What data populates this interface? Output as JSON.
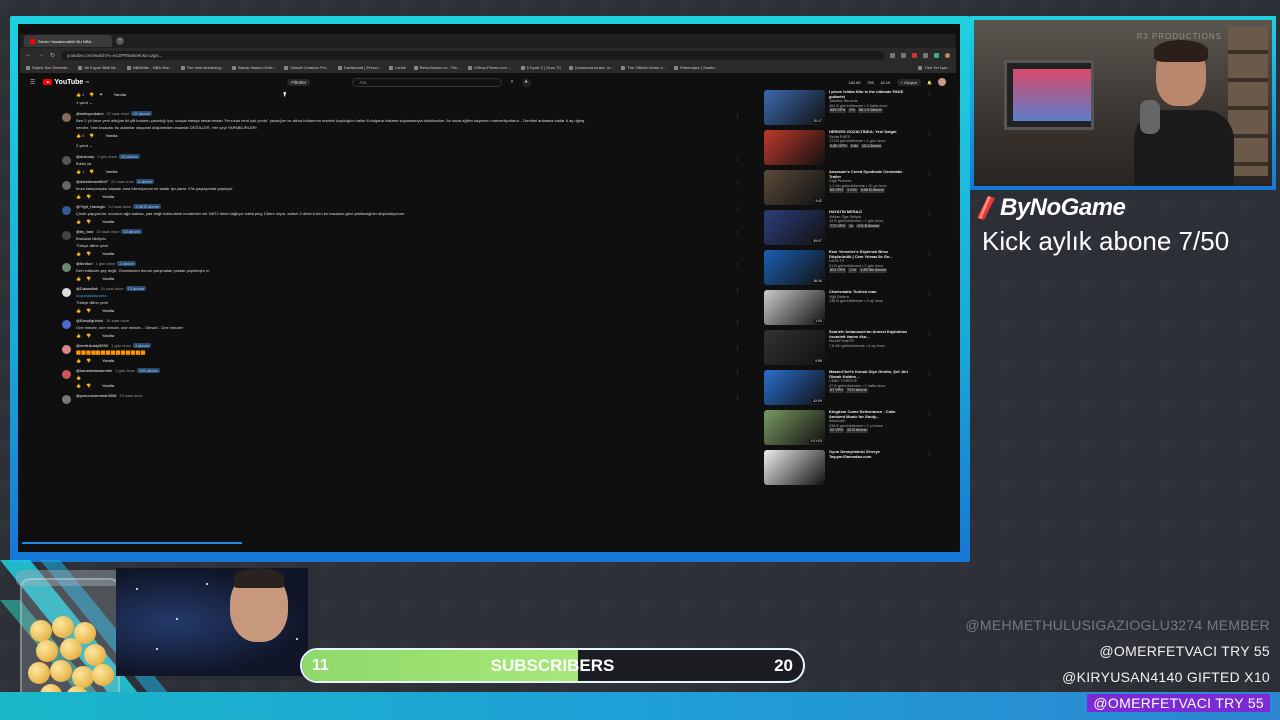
{
  "browser": {
    "tab_title": "Steam Yasaklanabilir BU NBA...",
    "url": "youtube.com/watch?v=e1ZPR9oBe9c&t=Ugxt...",
    "bookmarks": [
      "Süpriz Son Sevenle...",
      "Ali Koyun Bildi Mi...",
      "NBA/Nite - NBA Stre...",
      "The best streaming...",
      "Bando Namco Ente...",
      "Ubisoft Creators Pro...",
      "Dashboard | Prezzi...",
      "Lunkit",
      "RetroGames.cc - Pla...",
      "eShop-Prices.com -...",
      "5 Sport 2 | Zeus TV",
      "Download music, m...",
      "The Official Home o...",
      "Patreonpor | Seafer..."
    ],
    "bookmarks_right": "Tüm Yer İşar..."
  },
  "youtube": {
    "logo": "YouTube",
    "logo_sup": "TR",
    "filters_label": "Filtreler",
    "search_placeholder": "Ara",
    "create_label": "Oluştur",
    "hdr_stats": [
      "182.6K",
      "70K",
      "18.1K"
    ]
  },
  "comments": {
    "top_reply_label": "Yanıtla",
    "replies_toggle_1": "1 yanıt",
    "replies_toggle_2": "2 yanıt",
    "items": [
      {
        "user": "@selinyurdakul",
        "time": "22 saat önce",
        "badge": "22 abone",
        "text": "Ben 2 yıl önce yeni aldığım iki çift botumu çalındığı için, sosyal medya hesabımdan \"Hırsızlar beni çok yordu\" yazdığım ve alima botlarımın resmini koyduğum halde Erdoğana hakaret suçlamasıyla tutuklandım. Az daha eğitim hayatımı mahvediyorlardı... Derdimi anlatana kadar 6 ay uğraş",
        "text2": "verdim. Yani kısacası bu adamlar rasyonel düşünebilen insanlar DEĞİLLER, Her şeyi YAPABİLİRLER!",
        "likes": "6",
        "avatar": "#8a6b5a"
      },
      {
        "user": "@dukmay",
        "time": "1 gün önce",
        "badge": "19 abone",
        "text": "Bıktık ya",
        "likes": "1",
        "avatar": "#555"
      },
      {
        "user": "@darkdream8647",
        "time": "22 saat önce",
        "badge": "4 abone",
        "text": "İmza kampanyası başladı ama bilemiyorum ne kadar işe yarar. X'te paylaşımlar yapılıyor.",
        "likes": "",
        "avatar": "#666"
      },
      {
        "user": "@Yigit_Hacioglu",
        "time": "14 saat önce",
        "badge": "3,96 B abone",
        "text": "Çinde yaşıyorum, sorunun ağa babası, yan değil hollandiriei modemler ver NAT2 direk bağlıyor hatta ping 13lere iniyor, switch 2 direk A ben bu kasasun gezi çekileceğinin düşündüyorum.",
        "likes": "",
        "avatar": "#3b5998"
      },
      {
        "user": "@by_fard",
        "time": "20 saat önce",
        "badge": "15 abone",
        "text": "Bradalar bildiydu",
        "text2": "Türkçe diline çevir",
        "likes": "",
        "avatar": "#444"
      },
      {
        "user": "@tbr4furi",
        "time": "1 gün önce",
        "badge": "2 abone",
        "text": "Dert edilecek şey değil. Öncesinden bunun çalışmaları çoktan yapılmıştır m",
        "likes": "",
        "avatar": "#6a8a6a"
      },
      {
        "user": "@Dalsedlalt",
        "time": "16 saat önce",
        "badge": "73 abone",
        "text": "#oyunadalacama",
        "text2": "Türkçe diline çevir",
        "link": true,
        "likes": "",
        "avatar": "#ddd"
      },
      {
        "user": "@Bunyfigürlolu",
        "time": "16 saat önce",
        "badge": "",
        "text": "One minute, one minute, one minute... Olmaz!.. One minute!",
        "likes": "",
        "avatar": "#4a6ad0"
      },
      {
        "user": "@melinkutay5590",
        "time": "1 gün önce",
        "badge": "3 abone",
        "text": "🟧🟧🟧🟧🟧🟧🟧🟧🟧🟧🟧🟧🟧🟧",
        "likes": "",
        "avatar": "#d88"
      },
      {
        "user": "@karambakaremble",
        "time": "1 gün önce",
        "badge": "109 abone",
        "text": "👍",
        "likes": "",
        "avatar": "#c55"
      },
      {
        "user": "@yusuonverrsedr4968",
        "time": "22 saat önce",
        "badge": "",
        "text": "",
        "likes": "",
        "avatar": "#777"
      }
    ]
  },
  "sidebar": {
    "videos": [
      {
        "title": "I prove Ichika Nito is the ultimate FAKE guitarist",
        "channel": "Jakobra Records",
        "meta": "452 B görüntülenme • 2 hafta önce",
        "tags": [
          "459 VPH",
          "1%",
          "58.1 K Abone"
        ],
        "duration": "20:17",
        "thumb": "#3a6ab0"
      },
      {
        "title": "HERKES GÖZALTINDA: Yeni Dalga!",
        "channel": "Sedat ENES",
        "meta": "173 B görüntülenme • 1 gün önce",
        "tags": [
          "2,8K VPH",
          "0.8x",
          "12.1 Abone"
        ],
        "duration": "",
        "thumb": "#c0392b"
      },
      {
        "title": "Assassin's Creed Syndicate Cinematic Trailer",
        "channel": "Digit Pictures",
        "meta": "1,1 Mn görüntülenme • 10 yıl önce",
        "tags": [
          "55 VPH",
          "1 K0x",
          "5,68 B Abone"
        ],
        "duration": "4:42",
        "thumb": "#5a4a3a"
      },
      {
        "title": "HAYATIN MESAJI",
        "channel": "Volkan Öge Seliyor",
        "meta": "43 B görüntülenme • 2 gün önce",
        "tags": [
          "772 VPH",
          "1x",
          "101 B Abone"
        ],
        "duration": "39:07",
        "thumb": "#2c3e7a"
      },
      {
        "title": "Eser Yenenler'e Söylenek Birsz Düşünürülü | Cem Yılmaz İle Ge...",
        "channel": "KAYA TV",
        "meta": "91 B görüntülenme • 2 gün önce",
        "tags": [
          "821 VPH",
          "1.5x",
          "1,85 Mn Abone"
        ],
        "duration": "36:34",
        "thumb": "#1a5fb4"
      },
      {
        "title": "Charismatic Turkish man",
        "channel": "Yiğit Bisiera",
        "meta": "238 B görüntülenme • 5 ay önce",
        "tags": [],
        "duration": "1:00",
        "thumb": "#ccc"
      },
      {
        "title": "Scarlett Johansson'an Annesi Kaybolduz #scarlett #anne #ko...",
        "channel": "MovieFreakTR",
        "meta": "7,8 Mn görüntülenme • 6 ay önce",
        "tags": [],
        "duration": "0:59",
        "thumb": "#333"
      },
      {
        "title": "MasterChef'e Konuk Diye Girdim, Şef Jüri Olarak Kaldım ...",
        "channel": "CNBC TÜRKİYE",
        "meta": "47 B görüntülenme • 2 hafta önce",
        "tags": [
          "57 VPH",
          "73 K Abone"
        ],
        "duration": "42:09",
        "thumb": "#2a6fd0"
      },
      {
        "title": "Kingdom Come Deliverance - Calm Ambient Music for Study...",
        "channel": "Ildomusik",
        "meta": "238 B görüntülenme • 1 yıl önce",
        "tags": [
          "22 VPH",
          "42 B Abone"
        ],
        "duration": "2:01:03",
        "thumb": "#7a9a60"
      },
      {
        "title": "Oyun Deneyiminizi Zirveye Taşıyın!Gamedan.com",
        "channel": "",
        "meta": "",
        "tags": [],
        "duration": "",
        "thumb": "#eee"
      }
    ]
  },
  "overlay": {
    "brand": "ByNoGame",
    "kick_text": "Kick aylık abone 7/50",
    "cam_watermark": "R3 PRODUCTIONS",
    "sub_goal": {
      "current": "11",
      "label": "SUBSCRIBERS",
      "target": "20",
      "progress": 0.55
    },
    "events": [
      "@MEHMETHULUSIGAZIOGLU3274  MEMBER",
      "@OMERFETVACI  TRY 55",
      "@KIRYUSAN4140  GIFTED X10",
      "@OMERFETVACI  TRY 55"
    ]
  }
}
